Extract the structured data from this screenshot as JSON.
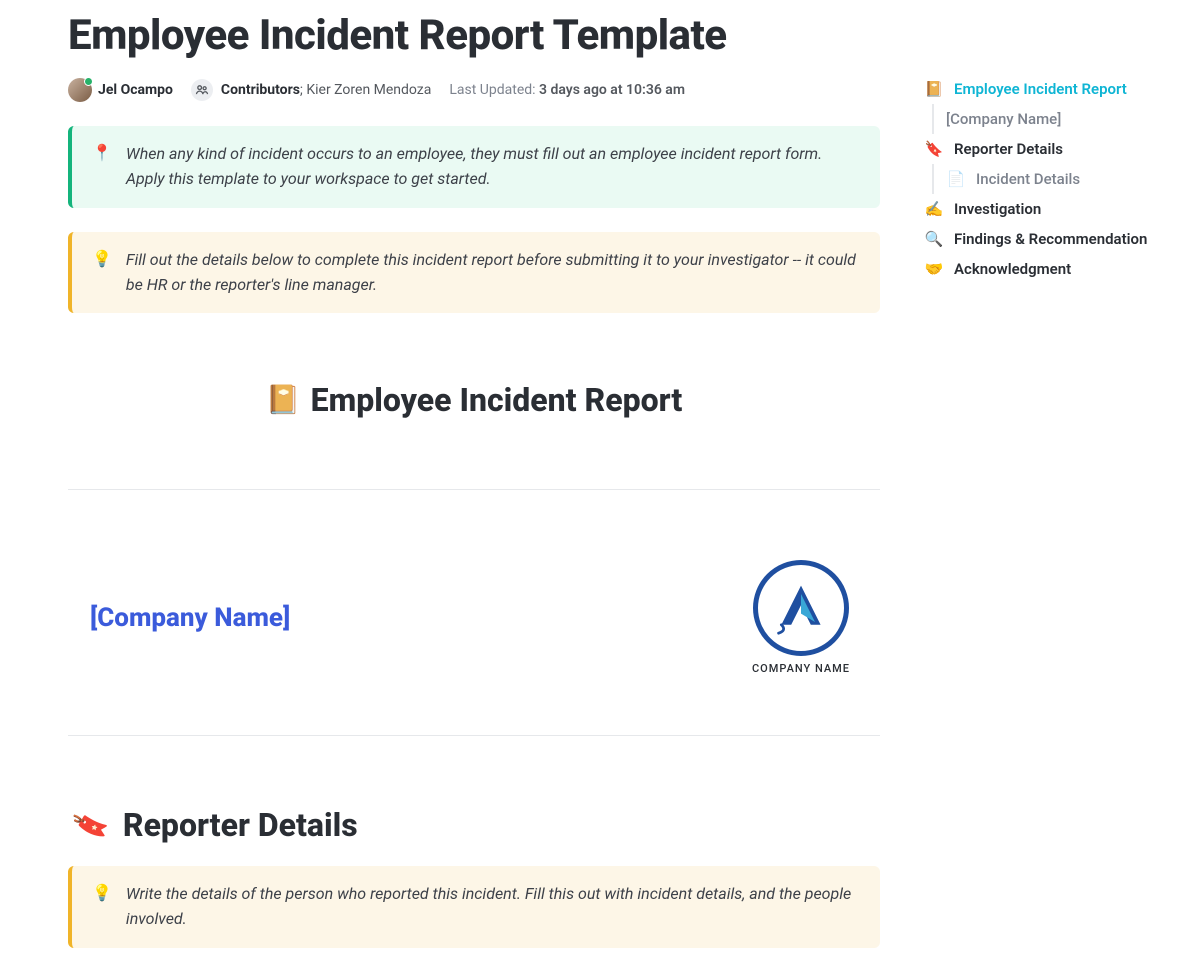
{
  "title": "Employee Incident Report Template",
  "author": "Jel Ocampo",
  "contributors_label": "Contributors",
  "contributors_separator": "; ",
  "contributors_names": "Kier Zoren Mendoza",
  "updated_label": "Last Updated: ",
  "updated_value": "3 days ago at 10:36 am",
  "callout_green": {
    "emoji": "📍",
    "text": "When any kind of incident occurs to an employee, they must fill out an employee incident report form. Apply this template to your workspace to get started."
  },
  "callout_yellow_1": {
    "emoji": "💡",
    "text": "Fill out the details below to complete this incident report before submitting it to your investigator -- it could be HR or the reporter's line manager."
  },
  "callout_yellow_2": {
    "emoji": "💡",
    "text": "Write the details of the person who reported this incident. Fill this out with incident details, and the people involved."
  },
  "section_report": {
    "emoji": "📔",
    "title": "Employee Incident Report"
  },
  "company_name": "[Company Name]",
  "logo_caption": "COMPANY NAME",
  "section_reporter": {
    "emoji": "🔖",
    "title": "Reporter Details"
  },
  "toc": [
    {
      "emoji": "📔",
      "label": "Employee Incident Report",
      "active": true,
      "sub": false
    },
    {
      "emoji": "",
      "label": "[Company Name]",
      "active": false,
      "sub": true
    },
    {
      "emoji": "🔖",
      "label": "Reporter Details",
      "active": false,
      "sub": false
    },
    {
      "emoji": "📄",
      "label": "Incident Details",
      "active": false,
      "sub": true,
      "icon_muted": true
    },
    {
      "emoji": "✍️",
      "label": "Investigation",
      "active": false,
      "sub": false
    },
    {
      "emoji": "🔍",
      "label": "Findings & Recommendation",
      "active": false,
      "sub": false
    },
    {
      "emoji": "🤝",
      "label": "Acknowledgment",
      "active": false,
      "sub": false
    }
  ]
}
